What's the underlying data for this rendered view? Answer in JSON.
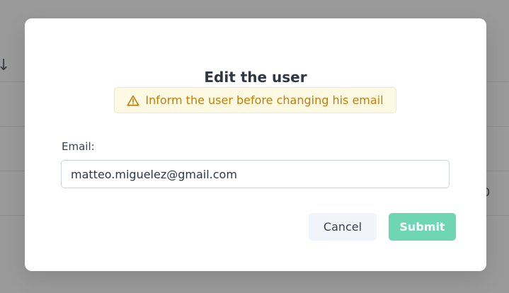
{
  "background": {
    "partial_cell_text": "0"
  },
  "modal": {
    "title": "Edit the user",
    "warning": {
      "icon": "warning-triangle-icon",
      "text": "Inform the user before changing his email"
    },
    "email_field": {
      "label": "Email:",
      "value": "matteo.miguelez@gmail.com"
    },
    "buttons": {
      "cancel_label": "Cancel",
      "submit_label": "Submit"
    }
  },
  "colors": {
    "overlay": "#8f8f8f",
    "warning_text": "#c07e06",
    "warning_bg": "#fef9e3",
    "submit_bg": "#6fd6b3",
    "cancel_bg": "#f1f4f8"
  }
}
